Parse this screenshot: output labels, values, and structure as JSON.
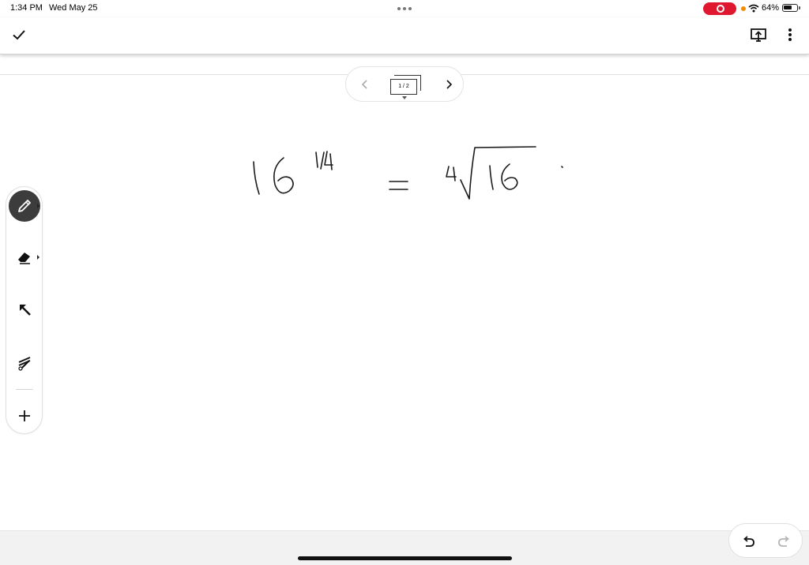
{
  "status_bar": {
    "time": "1:34 PM",
    "date": "Wed May 25",
    "battery_percent": "64%",
    "battery_level": 0.64,
    "recording_color": "#e0182f",
    "mic_indicator_color": "#f08c00"
  },
  "toolbar": {
    "done_icon": "checkmark-icon",
    "present_icon": "present-screen-icon",
    "more_icon": "more-vertical-icon"
  },
  "page_nav": {
    "page_indicator": "1 / 2",
    "prev_icon": "chevron-left-icon",
    "next_icon": "chevron-right-icon"
  },
  "tools": [
    {
      "name": "pen",
      "icon": "pen-icon",
      "active": true
    },
    {
      "name": "eraser",
      "icon": "eraser-icon",
      "active": false
    },
    {
      "name": "select",
      "icon": "arrow-select-icon",
      "active": false
    },
    {
      "name": "laser",
      "icon": "laser-pointer-icon",
      "active": false
    },
    {
      "name": "add",
      "icon": "plus-icon",
      "active": false
    }
  ],
  "history": {
    "undo_icon": "undo-icon",
    "redo_icon": "redo-icon"
  },
  "colors": {
    "active_tool_bg": "#3c3c3c",
    "ink": "#1a1a1a"
  }
}
